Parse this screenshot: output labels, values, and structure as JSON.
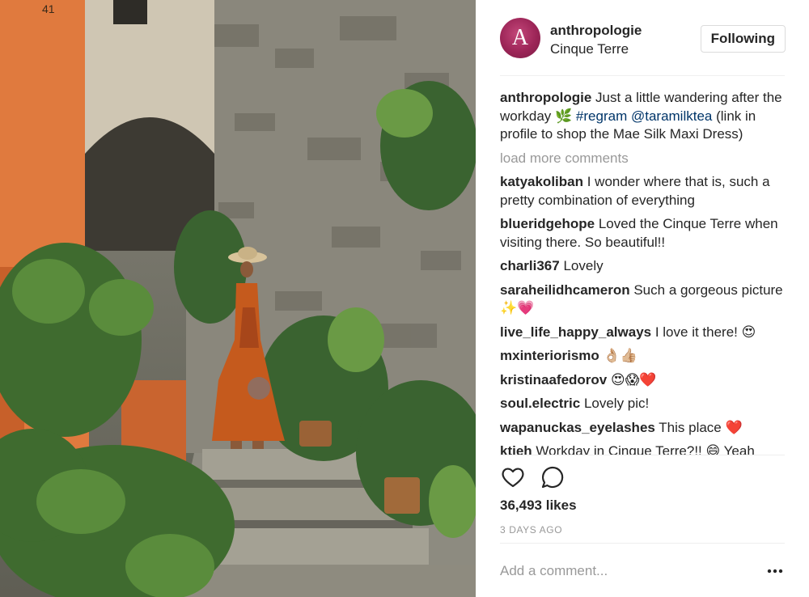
{
  "post": {
    "username": "anthropologie",
    "location": "Cinque Terre",
    "avatar_letter": "A",
    "follow_label": "Following",
    "caption": {
      "user": "anthropologie",
      "text_before": " Just a little wandering after the workday 🌿 ",
      "hashtag": "#regram",
      "mention": "@taramilktea",
      "text_after": " (link in profile to shop the Mae Silk Maxi Dress)"
    },
    "load_more": "load more comments",
    "comments": [
      {
        "user": "katyakoliban",
        "text": " I wonder where that is, such a pretty combination of everything"
      },
      {
        "user": "blueridgehope",
        "text": " Loved the Cinque Terre when visiting there. So beautiful!!"
      },
      {
        "user": "charli367",
        "text": " Lovely"
      },
      {
        "user": "saraheilidhcameron",
        "text": " Such a gorgeous picture ✨💗"
      },
      {
        "user": "live_life_happy_always",
        "text": " I love it there! 😍"
      },
      {
        "user": "mxinteriorismo",
        "text": " 👌🏼👍🏼"
      },
      {
        "user": "kristinaafedorov",
        "text": " 😍😱❤️"
      },
      {
        "user": "soul.electric",
        "text": " Lovely pic!"
      },
      {
        "user": "wapanuckas_eyelashes",
        "text": " This place ❤️"
      },
      {
        "user": "ktjeh",
        "text": " Workday in Cinque Terre?!! 😄 Yeah"
      }
    ],
    "likes": "36,493 likes",
    "date": "3 DAYS AGO",
    "add_comment_placeholder": "Add a comment...",
    "icons": {
      "like": "heart-outline-icon",
      "comment": "speech-bubble-icon",
      "more": "ellipsis-icon"
    },
    "colors": {
      "link": "#003569",
      "muted": "#999999",
      "avatar": "#9c2557"
    }
  }
}
